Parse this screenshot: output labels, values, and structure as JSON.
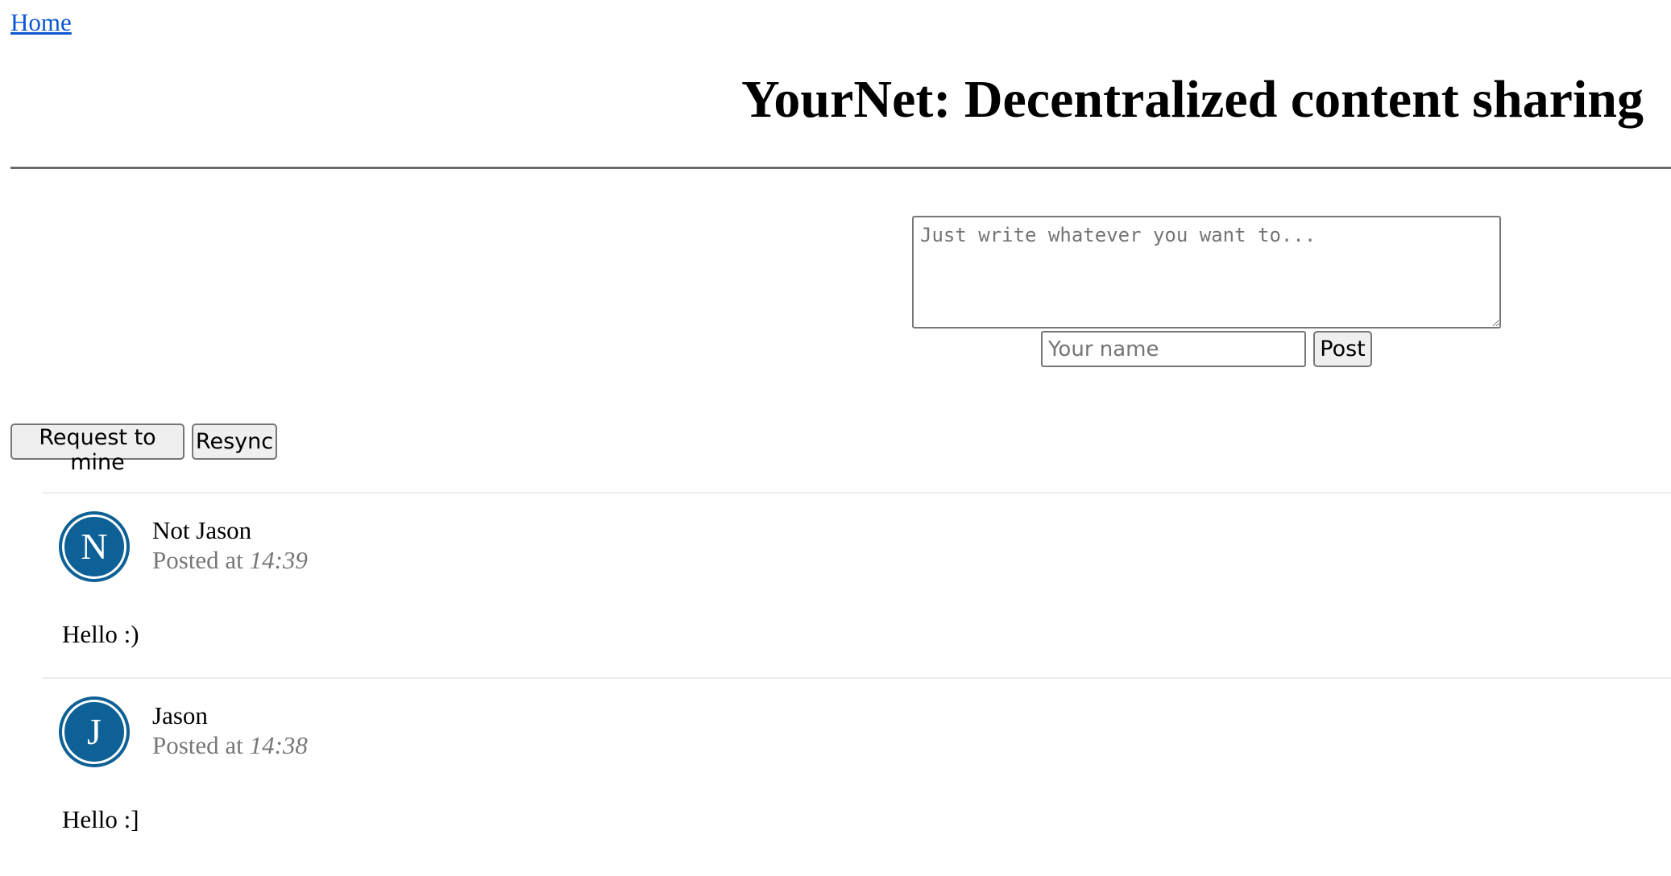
{
  "nav": {
    "home_label": "Home"
  },
  "header": {
    "title": "YourNet: Decentralized content sharing"
  },
  "compose": {
    "content_placeholder": "Just write whatever you want to...",
    "content_value": "",
    "name_placeholder": "Your name",
    "name_value": "",
    "post_label": "Post"
  },
  "actions": {
    "request_label": "Request to mine",
    "resync_label": "Resync"
  },
  "posts": [
    {
      "avatar_letter": "N",
      "author": "Not Jason",
      "posted_prefix": "Posted at",
      "time": "14:39",
      "body": "Hello :)"
    },
    {
      "avatar_letter": "J",
      "author": "Jason",
      "posted_prefix": "Posted at",
      "time": "14:38",
      "body": "Hello :]"
    }
  ],
  "colors": {
    "link": "#0b57d0",
    "avatar": "#0d6196",
    "meta_text": "#777777",
    "rule": "#6a6a6a"
  }
}
